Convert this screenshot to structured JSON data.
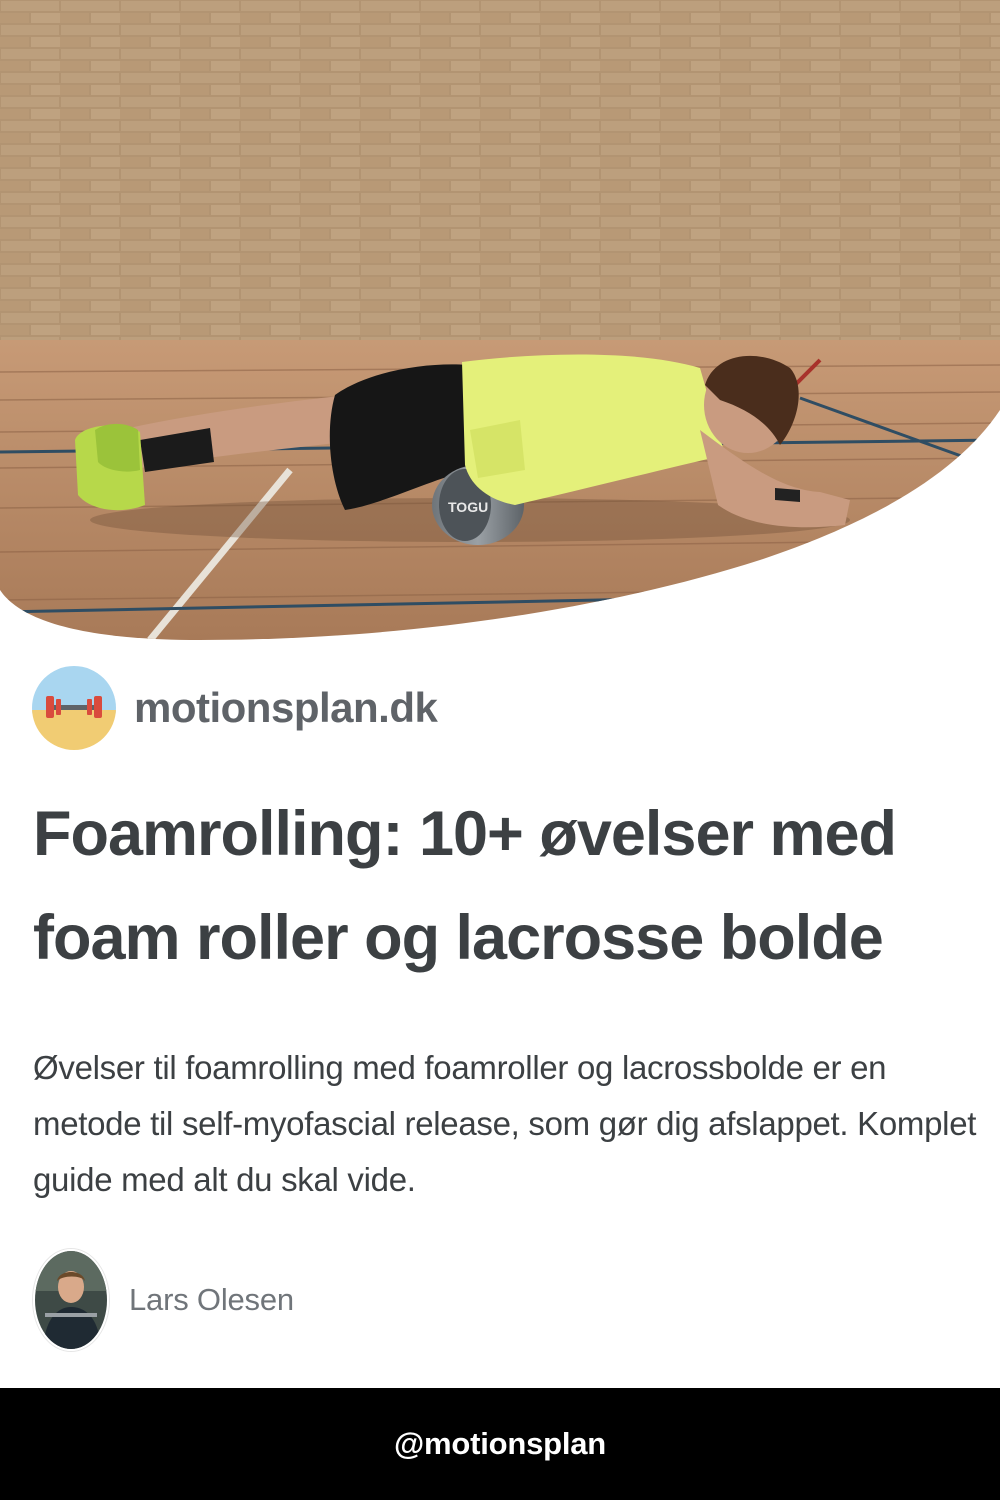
{
  "hero": {
    "image": "foam-rolling-plank-photo",
    "logo_text": "TOGU"
  },
  "brand": {
    "logo_icon": "barbell-beach-icon",
    "name": "motionsplan.dk"
  },
  "article": {
    "title": "Foamrolling: 10+ øvelser med foam roller og lacrosse bolde",
    "description": "Øvelser til foamrolling med foamroller og lacrossbolde er en metode til self-myofascial release, som gør dig afslappet. Komplet guide med alt du skal vide."
  },
  "author": {
    "avatar_icon": "author-photo",
    "name": "Lars Olesen"
  },
  "footer": {
    "handle": "@motionsplan"
  },
  "colors": {
    "text_dark": "#3c4043",
    "text_gray": "#5f6368",
    "footer_bg": "#000000",
    "shirt": "#e4f07a"
  }
}
